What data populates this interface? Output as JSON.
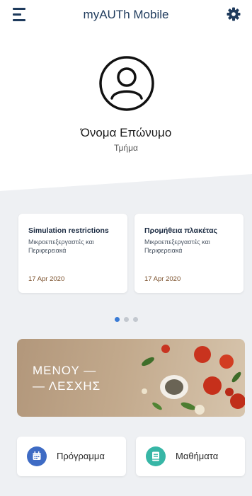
{
  "header": {
    "title": "myAUTh Mobile",
    "menu_icon": "hamburger-menu-icon",
    "settings_icon": "gear-icon",
    "accent": "#1e3a5c"
  },
  "profile": {
    "avatar_icon": "user-avatar-icon",
    "name": "Όνομα Επώνυμο",
    "department": "Τμήμα"
  },
  "announcements": [
    {
      "title": "Simulation restrictions",
      "subtitle": "Μικροεπεξεργαστές και Περιφερειακά",
      "date": "17 Apr 2020"
    },
    {
      "title": "Προμήθεια πλακέτας",
      "subtitle": "Μικροεπεξεργαστές και Περιφερειακά",
      "date": "17 Apr 2020"
    }
  ],
  "carousel": {
    "pages": 3,
    "active_page": 1
  },
  "banner": {
    "line1": "ΜΕΝΟΥ —",
    "line2": "— ΛΕΣΧΗΣ"
  },
  "buttons": [
    {
      "label": "Πρόγραμμα",
      "icon": "calendar-icon",
      "color": "#3e6bc4"
    },
    {
      "label": "Μαθήματα",
      "icon": "book-icon",
      "color": "#37b6a6"
    }
  ]
}
